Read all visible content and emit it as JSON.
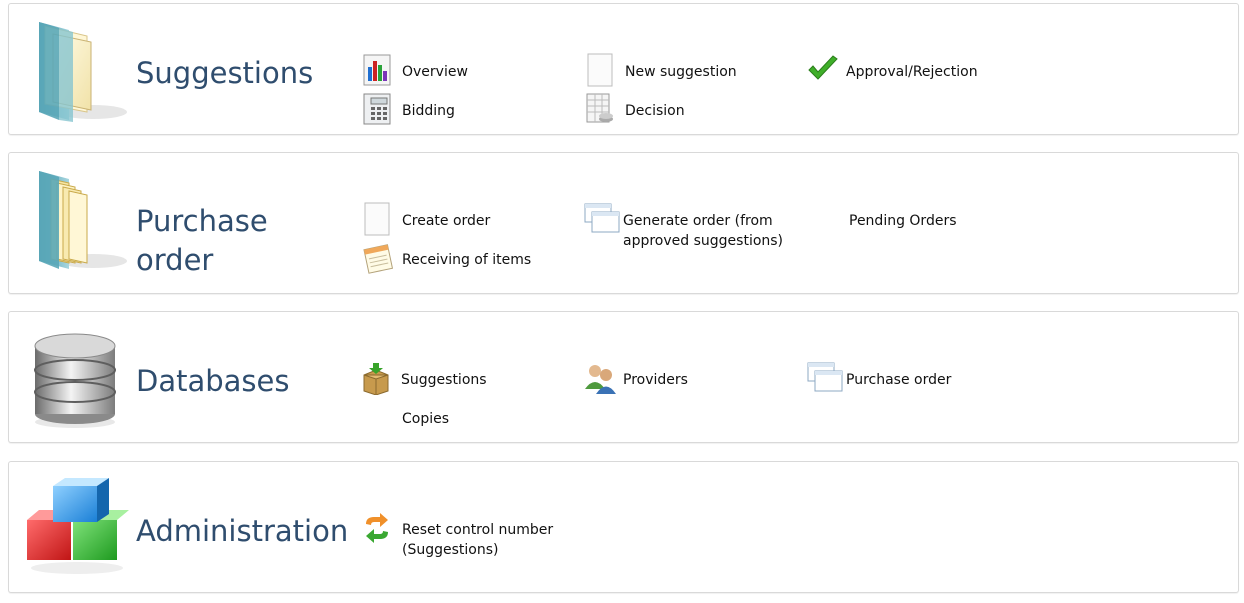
{
  "sections": {
    "suggestions": {
      "title": "Suggestions",
      "overview": "Overview",
      "new_suggestion": "New suggestion",
      "approval": "Approval/Rejection",
      "bidding": "Bidding",
      "decision": "Decision"
    },
    "purchase": {
      "title_line1": "Purchase",
      "title_line2": "order",
      "create_order": "Create order",
      "generate_line1": "Generate order (from",
      "generate_line2": "approved suggestions)",
      "pending_orders": "Pending Orders",
      "receiving": "Receiving of items"
    },
    "databases": {
      "title": "Databases",
      "suggestions": "Suggestions",
      "providers": "Providers",
      "purchase_order": "Purchase order",
      "copies": "Copies"
    },
    "administration": {
      "title": "Administration",
      "reset_line1": "Reset control number",
      "reset_line2": "(Suggestions)"
    }
  },
  "colors": {
    "title": "#2f4d6e",
    "panel_border": "#d9d9d9",
    "check_green": "#3fae29"
  },
  "icons": {
    "suggestions_section": "folder-icon",
    "purchase_section": "open-folder-icon",
    "databases_section": "database-icon",
    "administration_section": "cubes-icon",
    "overview": "bar-chart-icon",
    "new_suggestion": "blank-page-icon",
    "approval": "checkmark-icon",
    "bidding": "calculator-icon",
    "decision": "spreadsheet-icon",
    "create_order": "blank-page-icon",
    "generate_order": "windows-icon",
    "receiving": "notepad-icon",
    "db_suggestions": "box-download-icon",
    "providers": "users-icon",
    "purchase_order_db": "windows-icon",
    "reset": "refresh-arrows-icon"
  }
}
